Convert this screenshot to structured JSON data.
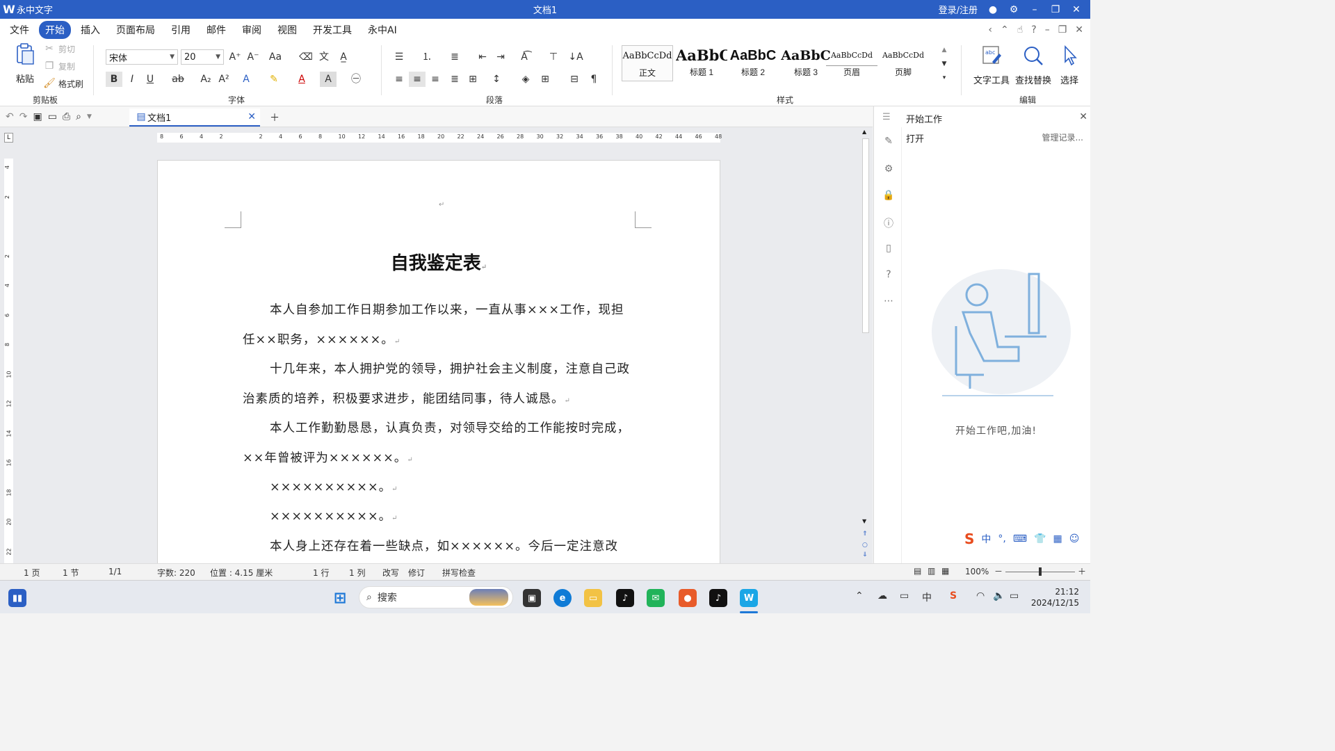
{
  "window": {
    "app_name": "永中文字",
    "doc_title": "文档1",
    "login": "登录/注册"
  },
  "menu": [
    "文件",
    "开始",
    "插入",
    "页面布局",
    "引用",
    "邮件",
    "审阅",
    "视图",
    "开发工具",
    "永中AI"
  ],
  "menu_active_index": 1,
  "ribbon": {
    "clipboard": {
      "paste": "粘贴",
      "cut": "剪切",
      "copy": "复制",
      "format_painter": "格式刷",
      "label": "剪贴板"
    },
    "font": {
      "name": "宋体",
      "size": "20",
      "label": "字体"
    },
    "paragraph": {
      "label": "段落"
    },
    "styles": {
      "label": "样式",
      "items": [
        {
          "sample": "AaBbCcDd",
          "name": "正文"
        },
        {
          "sample": "AaBbC",
          "name": "标题 1"
        },
        {
          "sample": "AaBbC",
          "name": "标题 2"
        },
        {
          "sample": "AaBbC",
          "name": "标题 3"
        },
        {
          "sample": "AaBbCcDd",
          "name": "页眉"
        },
        {
          "sample": "AaBbCcDd",
          "name": "页脚"
        }
      ]
    },
    "edit": {
      "label": "编辑",
      "text_tools": "文字工具",
      "find_replace": "查找替换",
      "select": "选择"
    }
  },
  "tab": {
    "name": "文档1"
  },
  "ruler": {
    "h": [
      "8",
      "6",
      "4",
      "2",
      "",
      "2",
      "4",
      "6",
      "8",
      "10",
      "12",
      "14",
      "16",
      "18",
      "20",
      "22",
      "24",
      "26",
      "28",
      "30",
      "32",
      "34",
      "36",
      "38",
      "40",
      "42",
      "44",
      "46",
      "48"
    ],
    "v": [
      "4",
      "2",
      "",
      "2",
      "4",
      "6",
      "8",
      "10",
      "12",
      "14",
      "16",
      "18",
      "20",
      "22"
    ],
    "corner": "L"
  },
  "document": {
    "title": "自我鉴定表",
    "paragraphs": [
      "本人自参加工作日期参加工作以来，一直从事×××工作，现担任××职务，××××××。",
      "十几年来，本人拥护党的领导，拥护社会主义制度，注意自己政治素质的培养，积极要求进步，能团结同事，待人诚恳。",
      "本人工作勤勤恳恳，认真负责，对领导交给的工作能按时完成，××年曾被评为××××××。",
      "××××××××××。",
      "××××××××××。",
      "本人身上还存在着一些缺点，如××××××。今后一定注意改"
    ]
  },
  "side_panel": {
    "title": "开始工作",
    "open": "打开",
    "manage": "管理记录...",
    "slogan": "开始工作吧,加油!"
  },
  "status": {
    "page": "1 页",
    "section": "1 节",
    "pages": "1/1",
    "words": "字数: 220",
    "position": "位置 : 4.15 厘米",
    "line": "1 行",
    "column": "1 列",
    "overwrite": "改写",
    "revise": "修订",
    "spell": "拼写检查",
    "zoom": "100%"
  },
  "taskbar": {
    "search": "搜索",
    "time": "21:12",
    "date": "2024/12/15",
    "ime": "中"
  },
  "colors": {
    "accent": "#2b5fc4"
  }
}
